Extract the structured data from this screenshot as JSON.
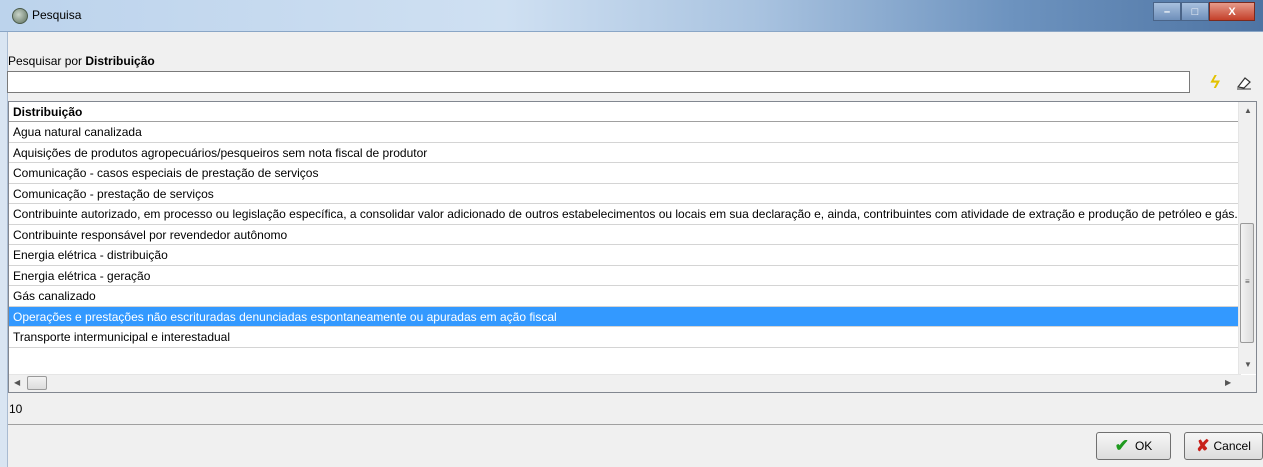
{
  "window": {
    "title": "Pesquisa",
    "minimize": "–",
    "maximize": "□",
    "close": "X"
  },
  "search": {
    "label_prefix": "Pesquisar por ",
    "label_field": "Distribuição",
    "value": "",
    "placeholder": ""
  },
  "grid": {
    "column_header": "Distribuição",
    "rows": [
      "Agua natural canalizada",
      "Aquisições de produtos agropecuários/pesqueiros sem nota fiscal de produtor",
      "Comunicação - casos especiais de prestação de serviços",
      "Comunicação - prestação de serviços",
      "Contribuinte autorizado, em processo ou legislação específica, a consolidar valor adicionado de outros estabelecimentos ou locais em sua declaração e, ainda, contribuintes com atividade de extração e produção de petróleo e gás.",
      "Contribuinte responsável por revendedor autônomo",
      "Energia elétrica - distribuição",
      "Energia elétrica - geração",
      "Gás canalizado",
      "Operações e prestações não escrituradas denunciadas espontaneamente ou apuradas em ação fiscal",
      "Transporte intermunicipal e interestadual"
    ],
    "selected_index": 9
  },
  "record_count": "10",
  "buttons": {
    "ok": "OK",
    "cancel": "Cancel"
  },
  "icons": {
    "search_execute": "lightning-icon",
    "clear": "eraser-icon",
    "ok": "check-icon",
    "cancel": "x-icon"
  },
  "colors": {
    "selection": "#3399ff",
    "ok_check": "#1e9a1e",
    "cancel_x": "#c8201a"
  }
}
